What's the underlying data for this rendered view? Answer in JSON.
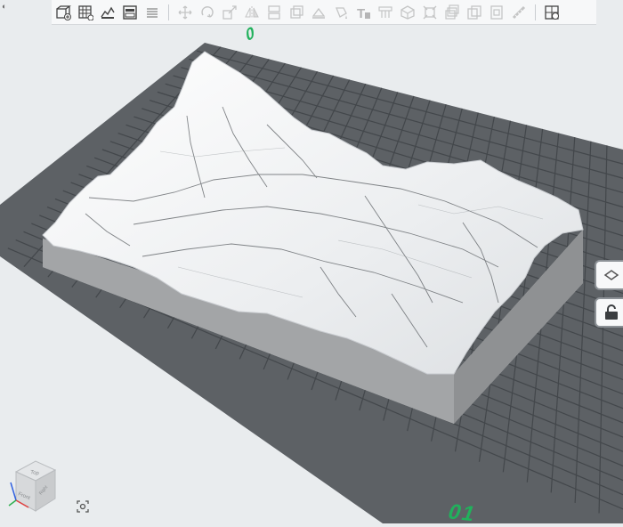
{
  "window": {
    "corner_icon": "window-menu-icon",
    "corner_glyph": "◐"
  },
  "toolbar": {
    "groups": [
      [
        "add-part-icon",
        "add-array-icon",
        "edit-terrain-icon",
        "layout-icon",
        "menu-lines-icon"
      ],
      [
        "move-icon",
        "rotate-icon",
        "scale-icon",
        "mirror-icon",
        "split-icon",
        "hollow-icon",
        "flatten-icon",
        "paint-icon",
        "text-icon",
        "support-icon",
        "box-icon",
        "resize-icon",
        "layers-icon",
        "copy-icon",
        "copy-alt-icon",
        "measure-icon"
      ],
      [
        "assembly-icon"
      ]
    ],
    "text_tool_label": "T"
  },
  "bed": {
    "front_label": "01",
    "back_label": "0",
    "grid_color": "#5c6064",
    "line_color": "#3c4044",
    "label_color": "#21b15c"
  },
  "model": {
    "terrain_color": "#f2f3f4",
    "base_color": "#a9abad"
  },
  "view_cube": {
    "faces": {
      "top": "Top",
      "front": "Front",
      "right": "Right"
    },
    "axis_colors": {
      "x": "#e04040",
      "y": "#30b050",
      "z": "#3060e0"
    }
  },
  "side_panel": {
    "buttons": [
      "layer-icon",
      "lock-icon"
    ]
  },
  "bottom_controls": {
    "fit_icon": "fit-view-icon"
  }
}
